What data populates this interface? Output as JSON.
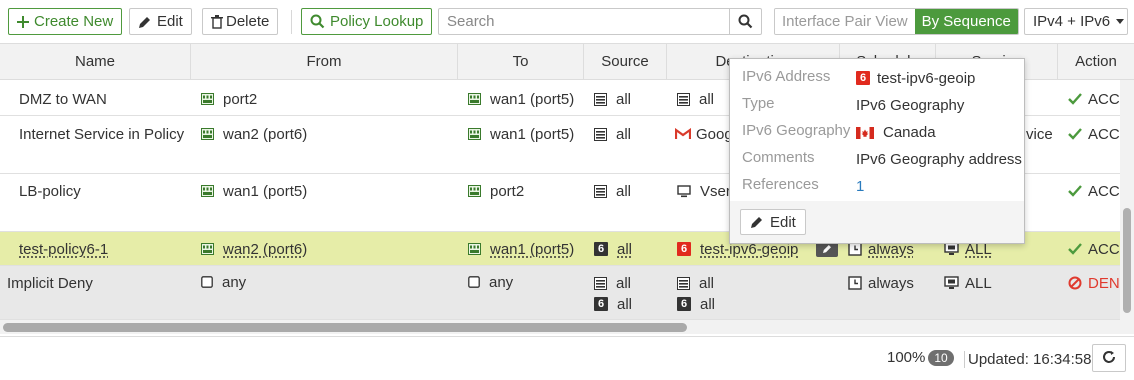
{
  "toolbar": {
    "create_new": "Create New",
    "edit": "Edit",
    "delete": "Delete",
    "policy_lookup": "Policy Lookup",
    "search_placeholder": "Search",
    "interface_pair_view": "Interface Pair View",
    "by_sequence": "By Sequence",
    "ip_version": "IPv4 + IPv6"
  },
  "columns": {
    "name": "Name",
    "from": "From",
    "to": "To",
    "source": "Source",
    "destination": "Destination",
    "schedule": "Schedule",
    "service": "Service",
    "action": "Action"
  },
  "rows": [
    {
      "name": "DMZ to WAN",
      "from": "port2",
      "to": "wan1 (port5)",
      "source": "all",
      "destination": "all",
      "action": "ACC"
    },
    {
      "name": "Internet Service in Policy",
      "from": "wan2 (port6)",
      "to": "wan1 (port5)",
      "source": "all",
      "destination": "Goog",
      "service_tail": "vice",
      "action": "ACC"
    },
    {
      "name": "LB-policy",
      "from": "wan1 (port5)",
      "to": "port2",
      "source": "all",
      "destination": "Vserv",
      "action": "ACC"
    },
    {
      "name": "test-policy6-1",
      "from": "wan2 (port6)",
      "to": "wan1 (port5)",
      "source": "all",
      "destination": "test-ipv6-geoip",
      "schedule": "always",
      "service": "ALL",
      "action": "ACC"
    },
    {
      "name": "Implicit Deny",
      "from": "any",
      "to": "any",
      "source_1": "all",
      "source_2": "all",
      "destination_1": "all",
      "destination_2": "all",
      "schedule": "always",
      "service": "ALL",
      "action": "DEN"
    }
  ],
  "tooltip": {
    "address_label": "IPv6 Address",
    "address_value": "test-ipv6-geoip",
    "type_label": "Type",
    "type_value": "IPv6 Geography",
    "geo_label": "IPv6 Geography",
    "geo_value": "Canada",
    "comments_label": "Comments",
    "comments_value": "IPv6 Geography address",
    "references_label": "References",
    "references_value": "1",
    "edit": "Edit",
    "ipv6_badge": "6"
  },
  "footer": {
    "zoom": "100%",
    "count": "10",
    "updated": "Updated: 16:34:58"
  },
  "colors": {
    "accent_green": "#4c9a3d",
    "selected_row": "#e6eda8",
    "deny_red": "#e03a2e",
    "ipv6_red": "#e12a1e"
  },
  "icons": {
    "interface": "interface-icon",
    "address": "address-icon",
    "ipv6_address": "ipv6-address-icon",
    "schedule": "clock-icon",
    "service": "service-icon",
    "accept": "check-icon",
    "deny": "deny-icon",
    "google": "gmail-icon",
    "vserver": "vserver-icon",
    "any": "square-icon"
  }
}
